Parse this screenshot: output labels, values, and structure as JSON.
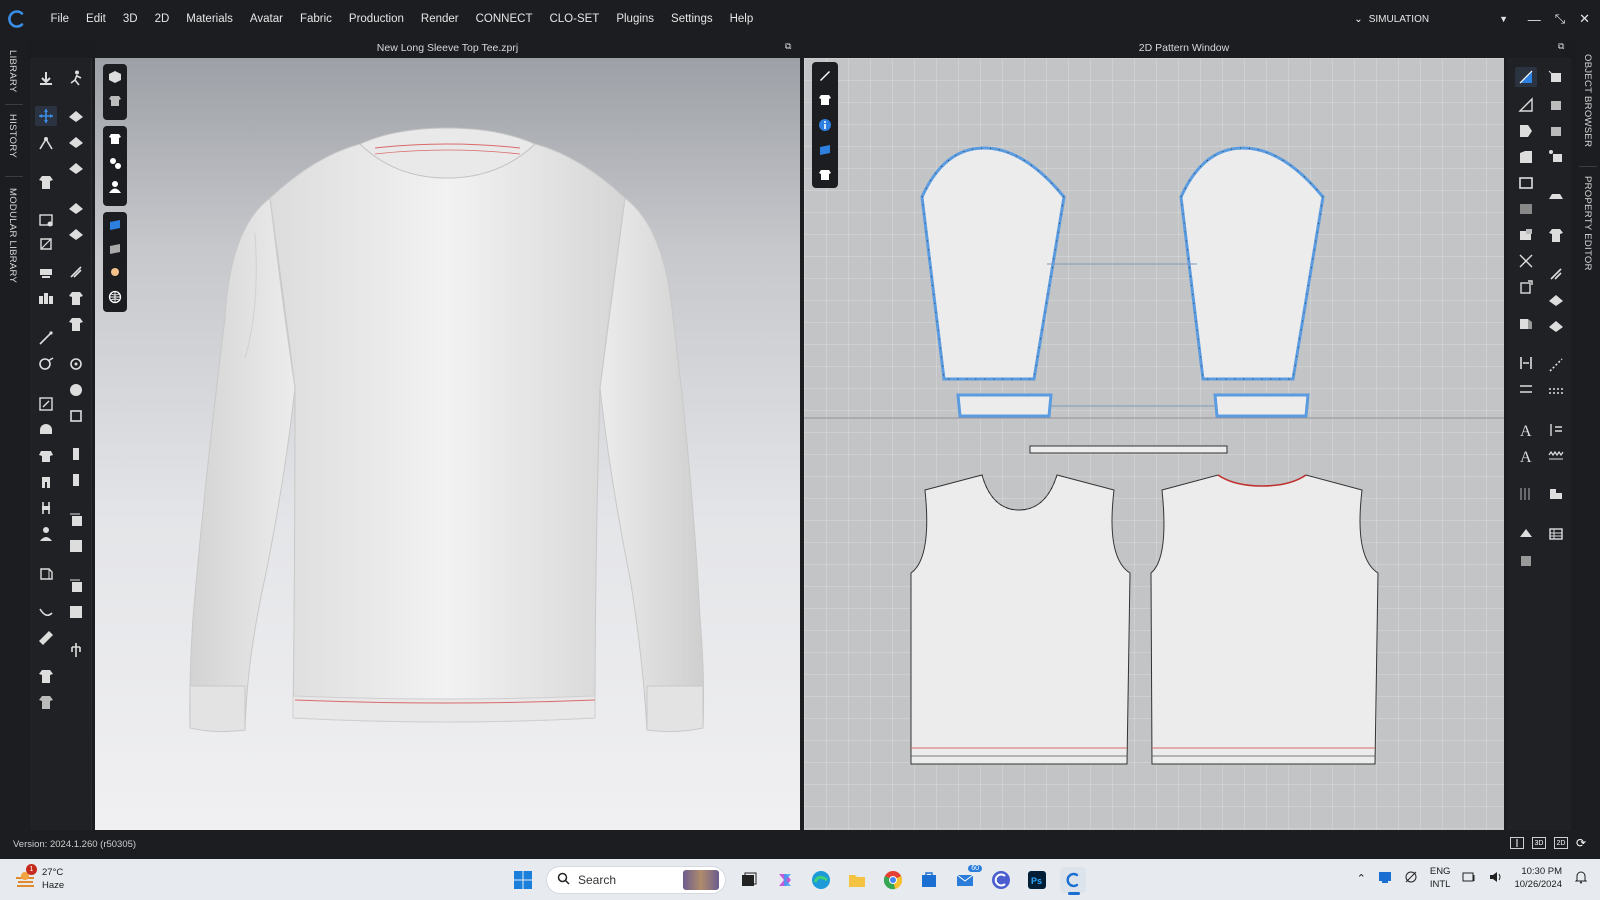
{
  "app": {
    "menu": [
      "File",
      "Edit",
      "3D",
      "2D",
      "Materials",
      "Avatar",
      "Fabric",
      "Production",
      "Render",
      "CONNECT",
      "CLO-SET",
      "Plugins",
      "Settings",
      "Help"
    ],
    "mode_label": "SIMULATION",
    "accent": "#2d7fe0"
  },
  "side_tabs": {
    "left": [
      "LIBRARY",
      "HISTORY",
      "MODULAR LIBRARY"
    ],
    "right": [
      "OBJECT BROWSER",
      "PROPERTY EDITOR"
    ]
  },
  "windows": {
    "view3d_title": "New Long Sleeve Top Tee.zprj",
    "view2d_title": "2D Pattern Window"
  },
  "status": {
    "version": "Version: 2024.1.260 (r50305)",
    "view_modes": [
      "",
      "3D",
      "2D",
      ""
    ]
  },
  "taskbar": {
    "weather_temp": "27°C",
    "weather_desc": "Haze",
    "weather_badge": "1",
    "search_placeholder": "Search",
    "mail_badge": "60",
    "lang_line1": "ENG",
    "lang_line2": "INTL",
    "time": "10:30 PM",
    "date": "10/26/2024"
  }
}
